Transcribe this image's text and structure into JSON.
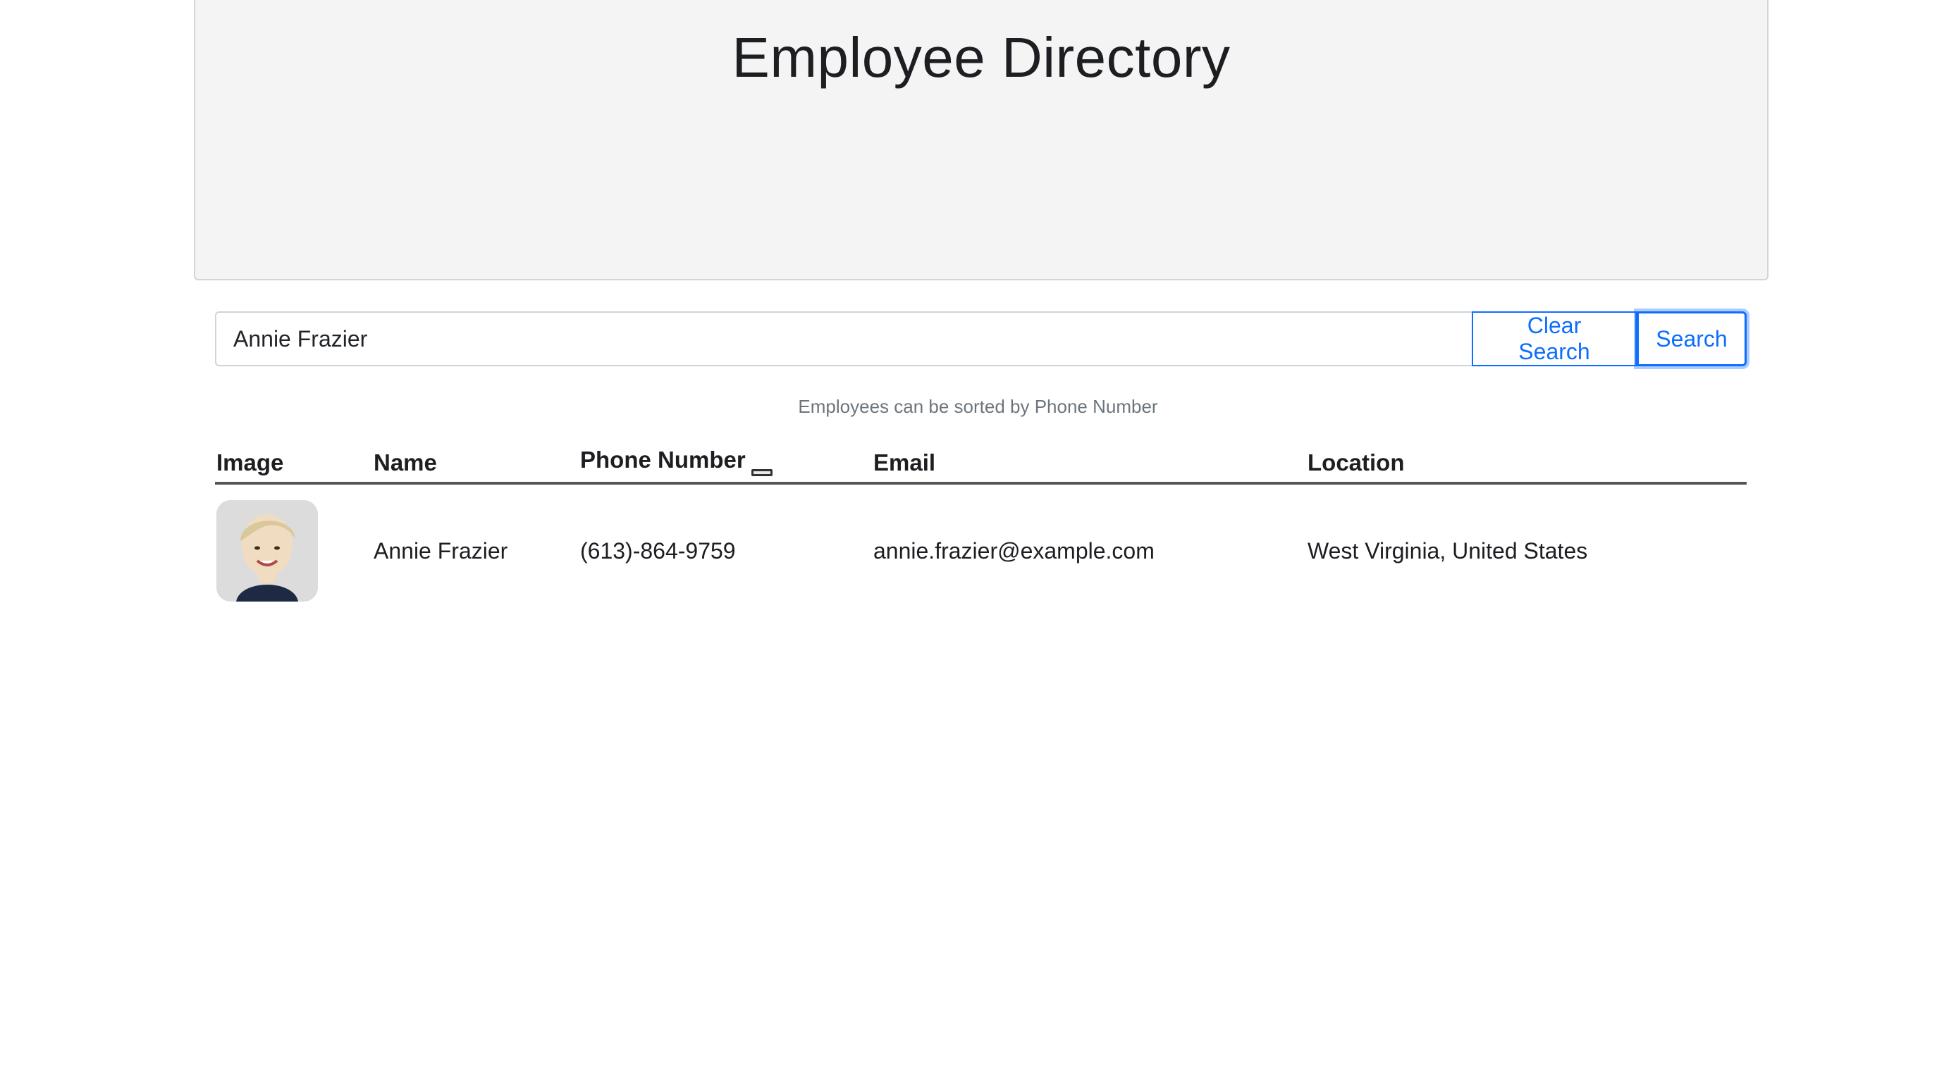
{
  "header": {
    "title": "Employee Directory"
  },
  "search": {
    "value": "Annie Frazier",
    "clear_label": "Clear Search",
    "search_label": "Search"
  },
  "sort_hint": "Employees can be sorted by Phone Number",
  "table": {
    "columns": [
      "Image",
      "Name",
      "Phone Number",
      "Email",
      "Location"
    ],
    "sorted_column": "Phone Number",
    "rows": [
      {
        "name": "Annie Frazier",
        "phone": "(613)-864-9759",
        "email": "annie.frazier@example.com",
        "location": "West Virginia, United States"
      }
    ]
  },
  "colors": {
    "primary": "#0d6efd",
    "jumbotron_bg": "#f4f4f4",
    "muted_text": "#6c757d"
  }
}
